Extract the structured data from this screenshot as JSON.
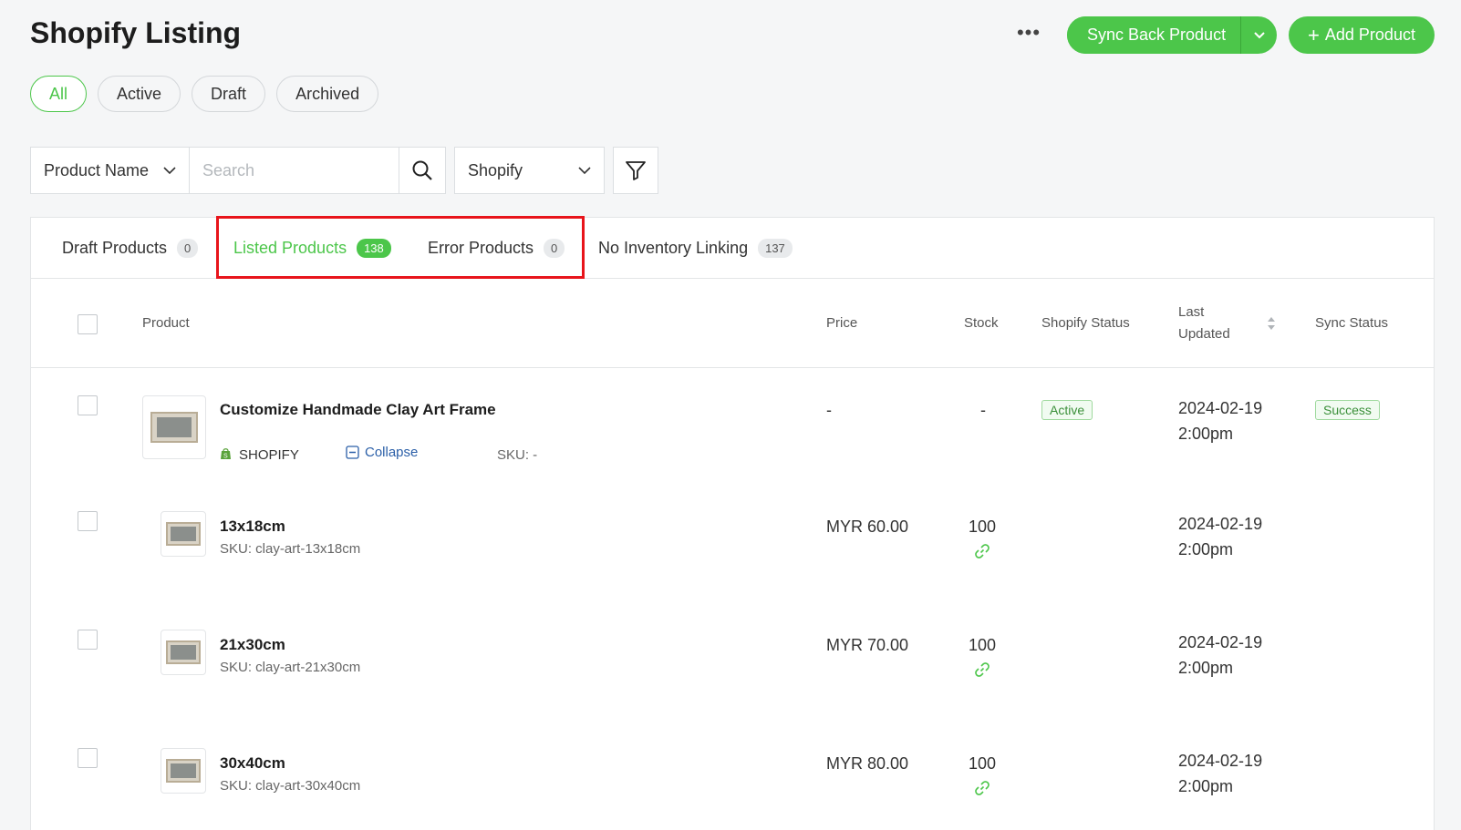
{
  "page": {
    "title": "Shopify Listing"
  },
  "header": {
    "more_label": "•••",
    "sync_label": "Sync Back Product",
    "add_label": "Add Product",
    "add_plus": "+"
  },
  "status_filters": [
    "All",
    "Active",
    "Draft",
    "Archived"
  ],
  "filters": {
    "field_select": "Product Name",
    "search_placeholder": "Search",
    "channel_select": "Shopify"
  },
  "tabs": [
    {
      "label": "Draft Products",
      "count": "0"
    },
    {
      "label": "Listed Products",
      "count": "138"
    },
    {
      "label": "Error Products",
      "count": "0"
    },
    {
      "label": "No Inventory Linking",
      "count": "137"
    }
  ],
  "table": {
    "headers": {
      "product": "Product",
      "price": "Price",
      "stock": "Stock",
      "shopify_status": "Shopify Status",
      "last_updated_1": "Last",
      "last_updated_2": "Updated",
      "sync_status": "Sync Status"
    },
    "parent": {
      "name": "Customize Handmade Clay Art Frame",
      "channel": "SHOPIFY",
      "collapse": "Collapse",
      "sku": "SKU: -",
      "price": "-",
      "stock": "-",
      "shopify_status": "Active",
      "date": "2024-02-19",
      "time": "2:00pm",
      "sync_status": "Success"
    },
    "variants": [
      {
        "name": "13x18cm",
        "sku": "SKU: clay-art-13x18cm",
        "price": "MYR 60.00",
        "stock": "100",
        "date": "2024-02-19",
        "time": "2:00pm"
      },
      {
        "name": "21x30cm",
        "sku": "SKU: clay-art-21x30cm",
        "price": "MYR 70.00",
        "stock": "100",
        "date": "2024-02-19",
        "time": "2:00pm"
      },
      {
        "name": "30x40cm",
        "sku": "SKU: clay-art-30x40cm",
        "price": "MYR 80.00",
        "stock": "100",
        "date": "2024-02-19",
        "time": "2:00pm"
      }
    ]
  },
  "colors": {
    "accent": "#4cc64a",
    "highlight": "#e8141b",
    "link": "#2b5fa8"
  },
  "icons": [
    "more-icon",
    "chevron-down-icon",
    "plus-icon",
    "search-icon",
    "filter-icon",
    "shopify-bag-icon",
    "collapse-icon",
    "link-icon",
    "sort-icon"
  ]
}
